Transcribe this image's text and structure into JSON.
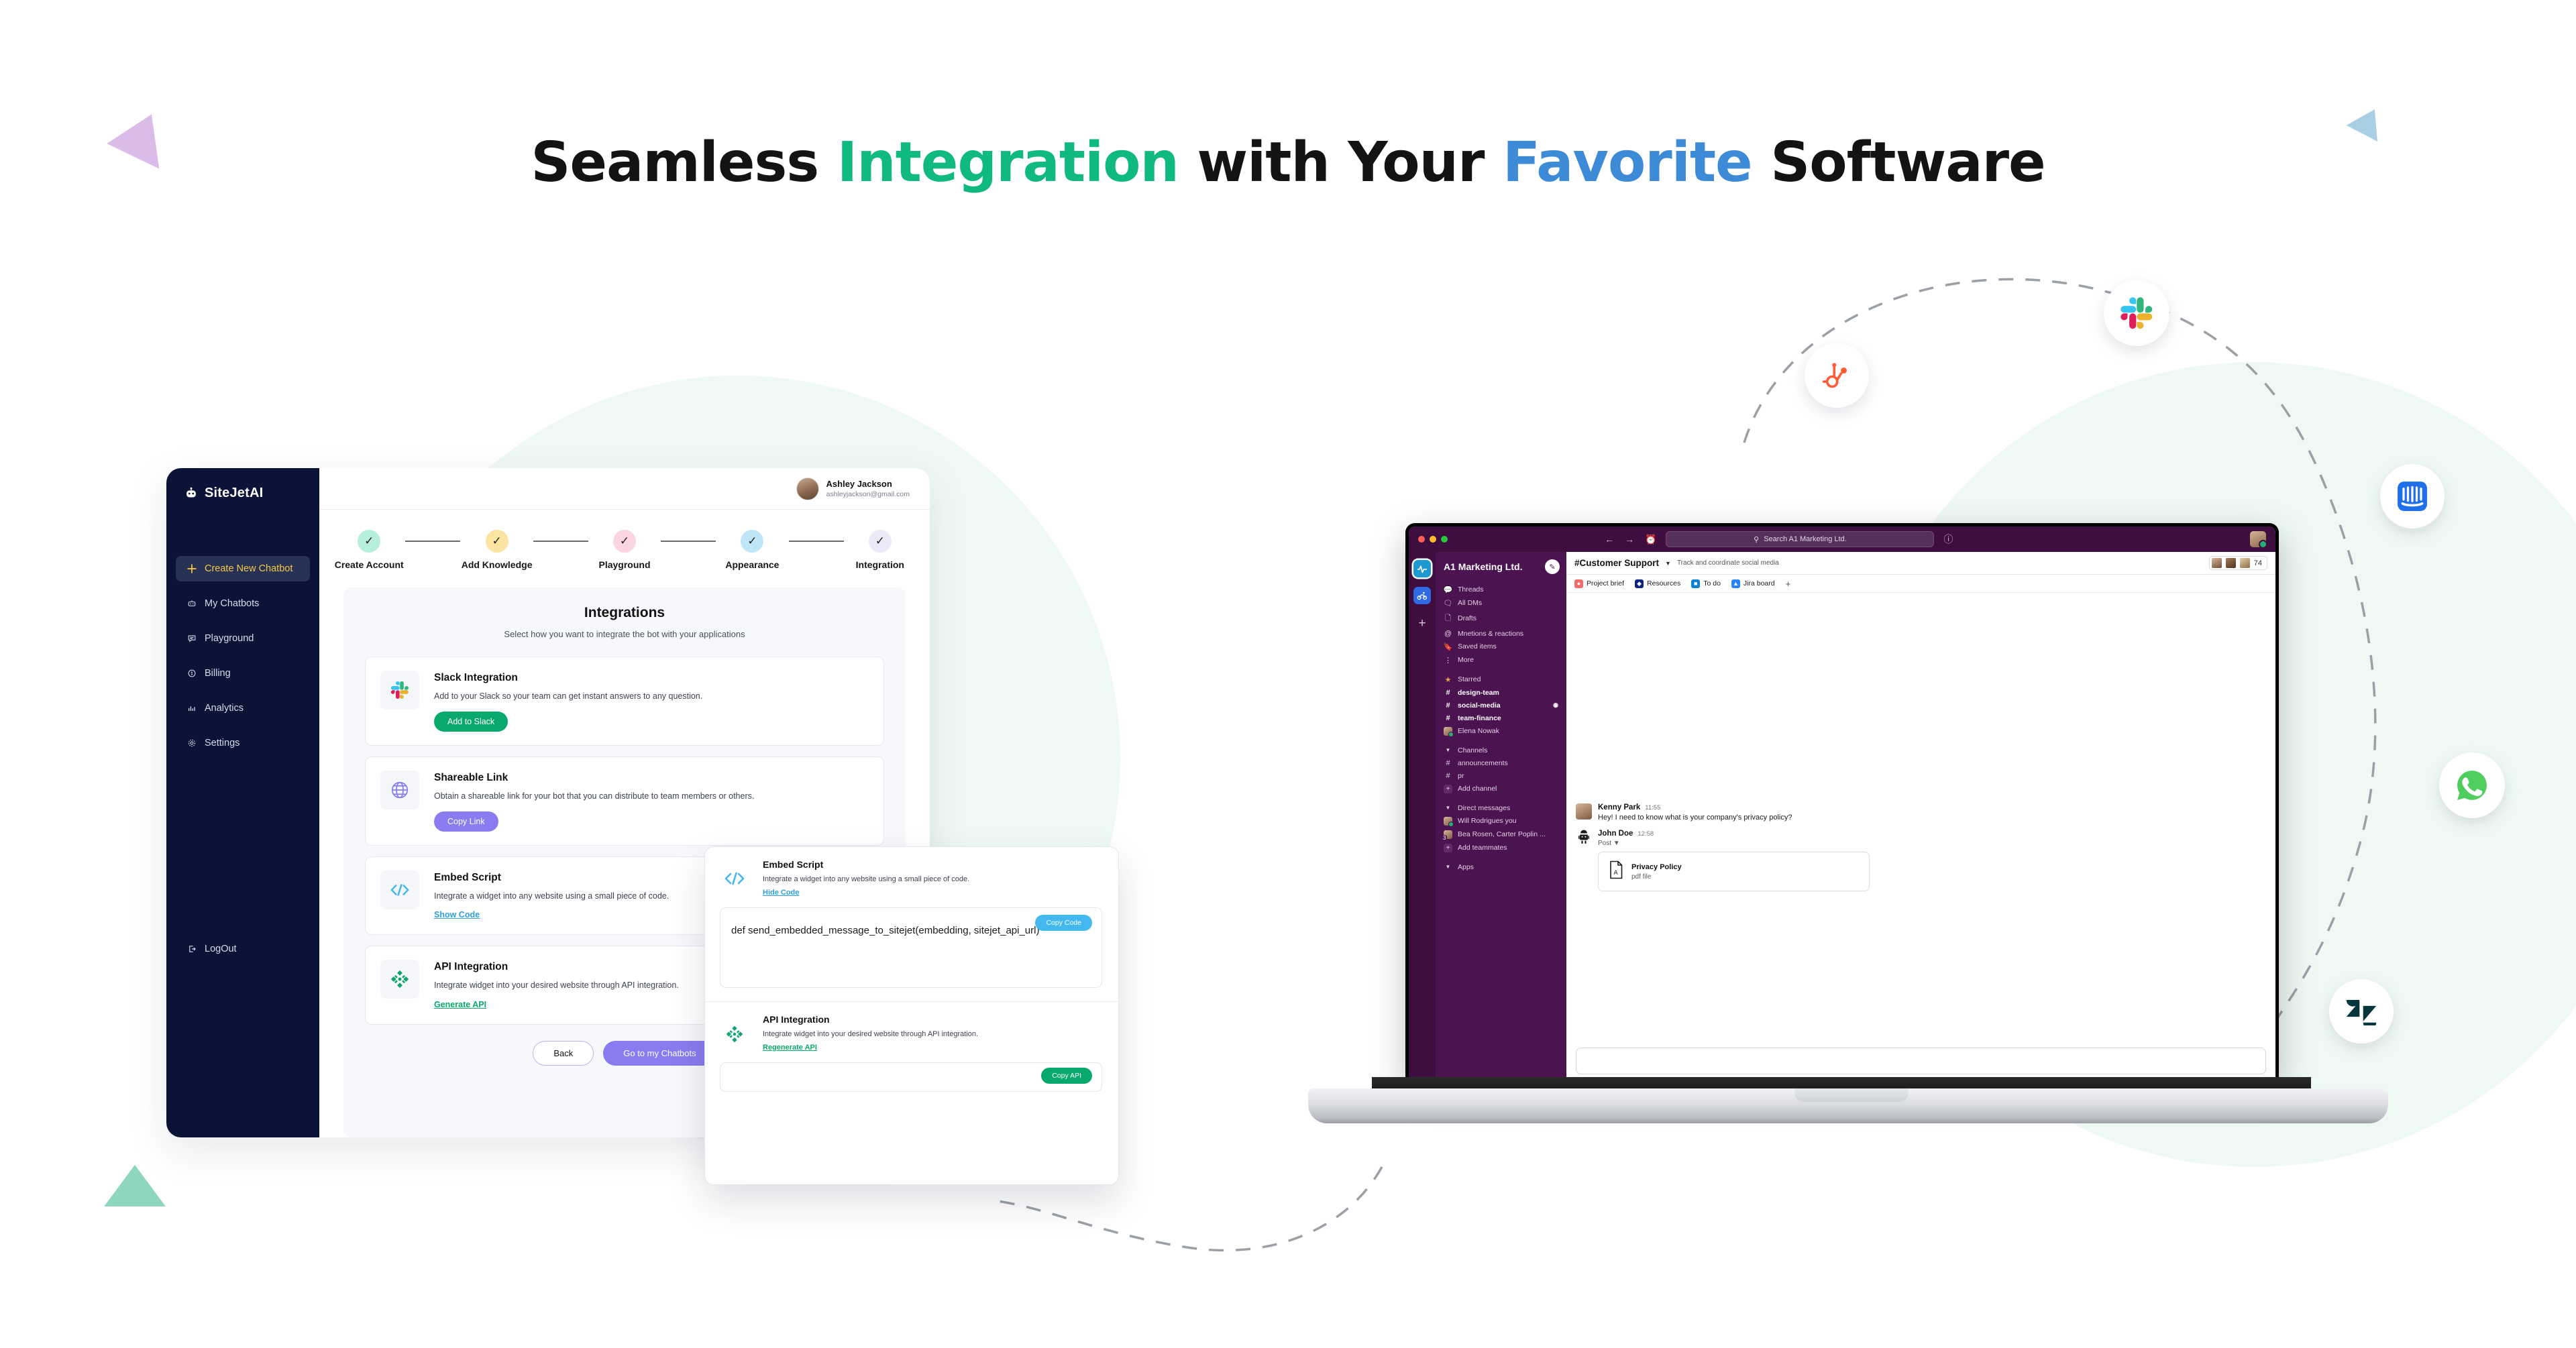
{
  "headline": {
    "part1": "Seamless ",
    "highlight1": "Integration",
    "part2": " with Your ",
    "highlight2": "Favorite",
    "part3": " Software",
    "highlight1_color": "#10b981",
    "highlight2_color": "#3d8bd6"
  },
  "sitejet": {
    "brand": "SiteJetAI",
    "nav": [
      {
        "label": "Create New Chatbot",
        "icon": "plus-icon",
        "active": true
      },
      {
        "label": "My Chatbots",
        "icon": "robot-icon",
        "active": false
      },
      {
        "label": "Playground",
        "icon": "chat-icon",
        "active": false
      },
      {
        "label": "Billing",
        "icon": "dollar-icon",
        "active": false
      },
      {
        "label": "Analytics",
        "icon": "bar-chart-icon",
        "active": false
      },
      {
        "label": "Settings",
        "icon": "gear-icon",
        "active": false
      }
    ],
    "logout": {
      "label": "LogOut",
      "icon": "logout-icon"
    },
    "user": {
      "name": "Ashley Jackson",
      "email": "ashleyjackson@gmail.com"
    },
    "steps": [
      {
        "label": "Create Account",
        "color": "#b6f0dc",
        "done": true
      },
      {
        "label": "Add Knowledge",
        "color": "#fbe4a2",
        "done": true
      },
      {
        "label": "Playground",
        "color": "#fbd5e2",
        "done": true
      },
      {
        "label": "Appearance",
        "color": "#bfe6f7",
        "done": true
      },
      {
        "label": "Integration",
        "color": "#eceaf7",
        "done": true
      }
    ],
    "panel": {
      "title": "Integrations",
      "subtitle": "Select how you want to integrate the bot with your applications",
      "cards": [
        {
          "title": "Slack Integration",
          "desc": "Add to your Slack so your team can get instant answers to any question.",
          "action_label": "Add to Slack",
          "action_type": "pill-green",
          "icon": "slack-icon"
        },
        {
          "title": "Shareable Link",
          "desc": "Obtain a shareable link for your bot that you can distribute to team members or others.",
          "action_label": "Copy Link",
          "action_type": "pill-purple",
          "icon": "globe-icon"
        },
        {
          "title": "Embed Script",
          "desc": "Integrate a widget into any website using a small piece of code.",
          "action_label": "Show Code",
          "action_type": "link-blue",
          "icon": "code-icon"
        },
        {
          "title": "API Integration",
          "desc": "Integrate widget into your desired website through API integration.",
          "action_label": "Generate API",
          "action_type": "link-green",
          "icon": "api-icon"
        }
      ],
      "back_label": "Back",
      "next_label": "Go to my Chatbots"
    }
  },
  "overlay": {
    "embed": {
      "title": "Embed Script",
      "desc": "Integrate a widget into any website using a small piece of code.",
      "link_label": "Hide Code",
      "copy_label": "Copy Code",
      "code": "def send_embedded_message_to_sitejet(embedding, sitejet_api_url)"
    },
    "api": {
      "title": "API Integration",
      "desc": "Integrate widget into your desired website through API integration.",
      "link_label": "Regenerate API",
      "copy_label": "Copy API",
      "value": ""
    }
  },
  "slack": {
    "titlebar": {
      "search_placeholder": "Search A1 Marketing Ltd.",
      "search_icon": "search-icon",
      "back_icon": "arrow-left-icon",
      "forward_icon": "arrow-right-icon",
      "history_icon": "clock-icon",
      "help_icon": "question-icon",
      "dots": [
        "#ff5f57",
        "#febc2e",
        "#28c840"
      ]
    },
    "workspace": {
      "name": "A1 Marketing Ltd.",
      "compose_icon": "pencil-icon"
    },
    "sidebar_primary": [
      {
        "label": "Threads",
        "icon": "threads-icon"
      },
      {
        "label": "All DMs",
        "icon": "dms-icon"
      },
      {
        "label": "Drafts",
        "icon": "drafts-icon"
      },
      {
        "label": "Mnetions & reactions",
        "icon": "at-icon"
      },
      {
        "label": "Saved items",
        "icon": "bookmark-icon"
      },
      {
        "label": "More",
        "icon": "more-icon"
      }
    ],
    "starred": {
      "label": "Starred",
      "icon": "star-icon",
      "items": [
        {
          "label": "design-team",
          "prefix": "#",
          "bold": true
        },
        {
          "label": "social-media",
          "prefix": "#",
          "bold": true,
          "trailing_icon": "mute-icon"
        },
        {
          "label": "team-finance",
          "prefix": "#",
          "bold": true
        },
        {
          "label": "Elena Nowak",
          "prefix": "avatar",
          "online": true
        }
      ]
    },
    "channels": {
      "label": "Channels",
      "items": [
        {
          "label": "announcements",
          "prefix": "#"
        },
        {
          "label": "pr",
          "prefix": "#"
        },
        {
          "label": "Add channel",
          "prefix": "+"
        }
      ]
    },
    "dms": {
      "label": "Direct messages",
      "items": [
        {
          "label": "Will Rodrigues you",
          "prefix": "avatar",
          "online": true
        },
        {
          "label": "Bea Rosen, Carter Poplin ...",
          "prefix": "avatar",
          "badge": "3"
        },
        {
          "label": "Add teammates",
          "prefix": "+"
        }
      ]
    },
    "apps": {
      "label": "Apps"
    },
    "channel": {
      "name": "#Customer Support",
      "topic": "Track and coordinate social media",
      "member_count": "74"
    },
    "tabs": [
      {
        "label": "Project brief",
        "icon": "asana-icon",
        "color": "#f06a6a"
      },
      {
        "label": "Resources",
        "icon": "dropbox-icon",
        "color": "#0d2481"
      },
      {
        "label": "To do",
        "icon": "trello-icon",
        "color": "#0b80d1"
      },
      {
        "label": "Jira board",
        "icon": "jira-icon",
        "color": "#2684ff"
      }
    ],
    "tab_add": "+",
    "messages": [
      {
        "author": "Kenny Park",
        "time": "11:55",
        "text": "Hey! I need to know what is your company's privacy policy?",
        "avatar": "photo"
      },
      {
        "author": "John Doe",
        "time": "12:58",
        "meta": "Post",
        "avatar": "bot",
        "attachment": {
          "title": "Privacy Policy",
          "subtitle": "pdf file",
          "icon": "pdf-icon"
        }
      }
    ]
  },
  "floating_logos": [
    {
      "name": "hubspot-icon",
      "label": "HubSpot"
    },
    {
      "name": "slack-icon",
      "label": "Slack"
    },
    {
      "name": "intercom-icon",
      "label": "Intercom"
    },
    {
      "name": "whatsapp-icon",
      "label": "WhatsApp"
    },
    {
      "name": "zendesk-icon",
      "label": "Zendesk"
    }
  ]
}
